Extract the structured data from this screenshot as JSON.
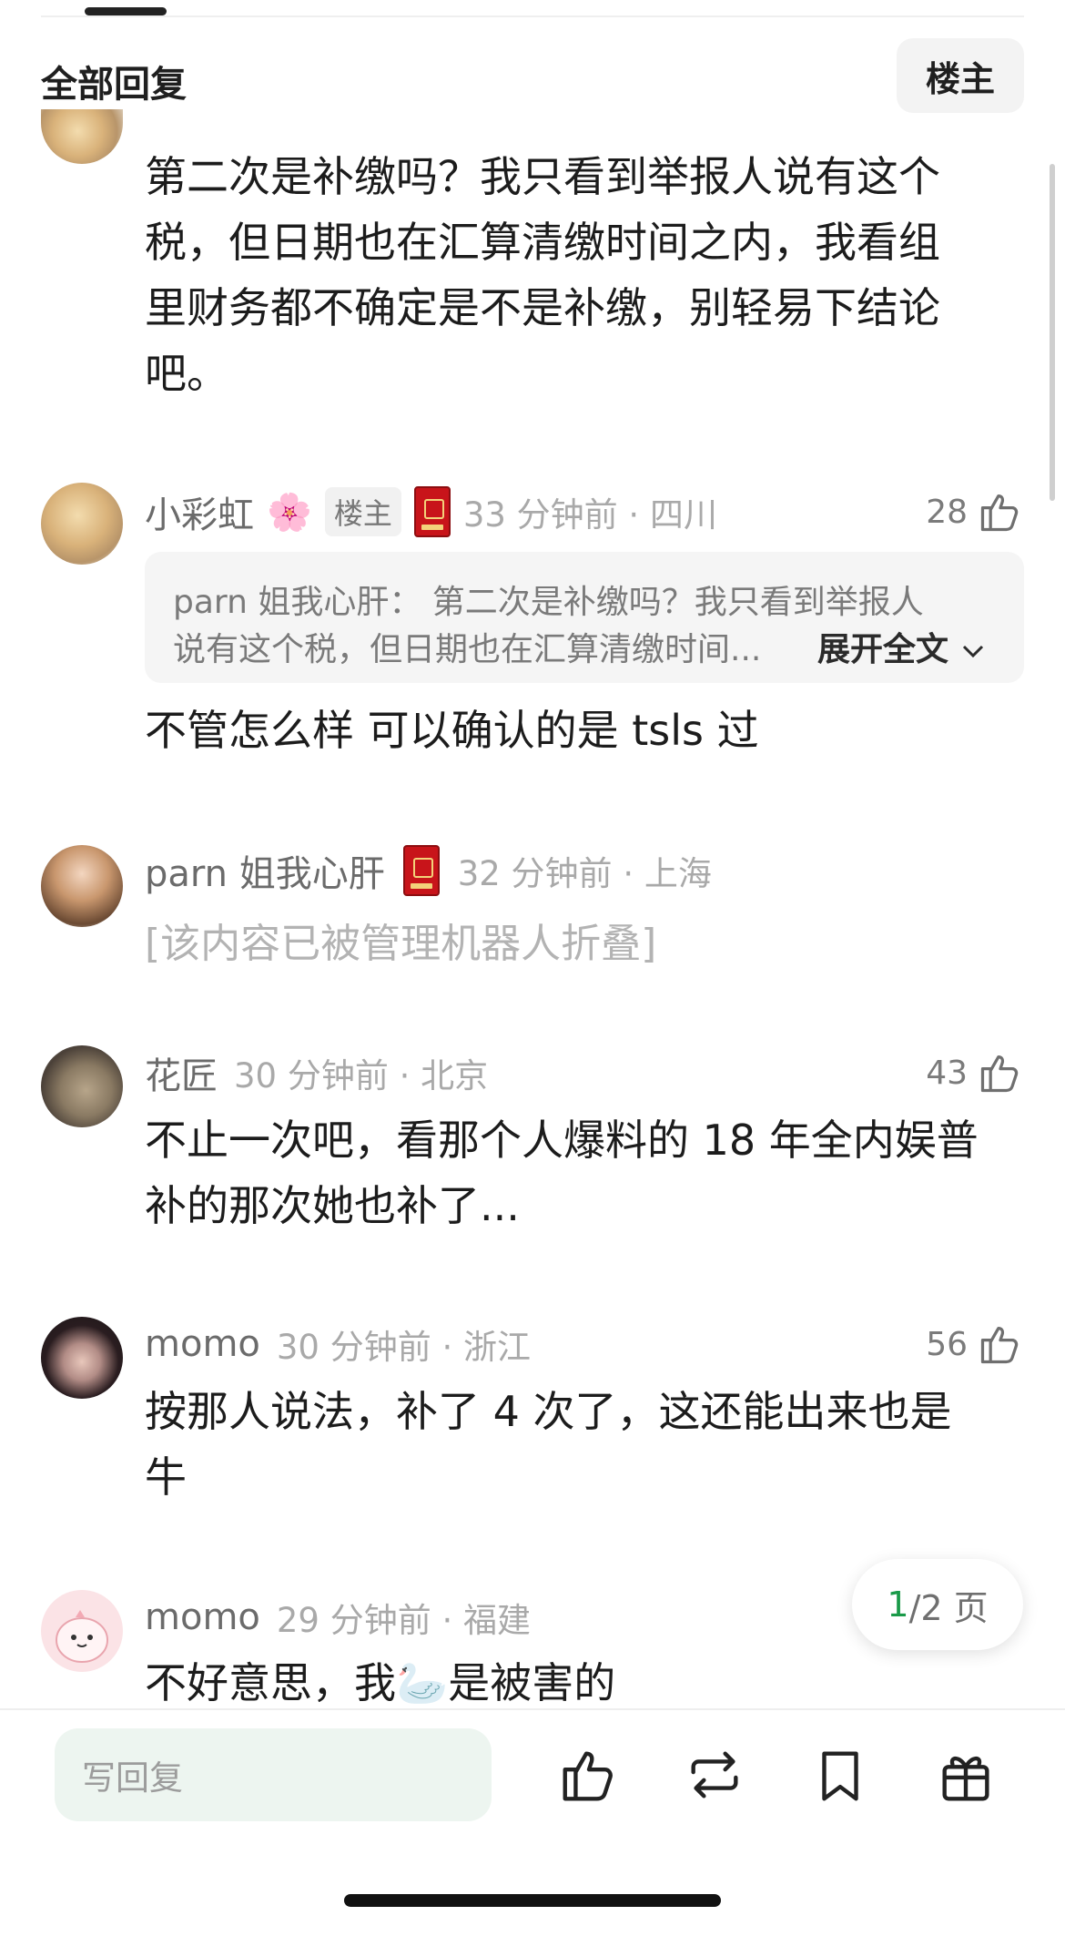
{
  "header": {
    "title": "全部回复",
    "op_filter_label": "楼主"
  },
  "comments": [
    {
      "text": "第二次是补缴吗？我只看到举报人说有这个税，但日期也在汇算清缴时间之内，我看组里财务都不确定是不是补缴，别轻易下结论吧。",
      "lines": [
        "第二次是补缴吗？我只看到举报人说有这个",
        "税，但日期也在汇算清缴时间之内，我看组",
        "里财务都不确定是不是补缴，别轻易下结论",
        "吧。"
      ]
    },
    {
      "username": "小彩虹",
      "flower_emoji": "🌸",
      "badge": "楼主",
      "time_location": "33 分钟前 · 四川",
      "likes": "28",
      "quote_line1": "parn 姐我心肝：  第二次是补缴吗？我只看到举报人",
      "quote_line2": "说有这个税，但日期也在汇算清缴时间...",
      "quote_expand": "展开全文",
      "text": "不管怎么样 可以确认的是 tsls 过"
    },
    {
      "username": "parn 姐我心肝",
      "time_location": "32 分钟前 · 上海",
      "text": "[该内容已被管理机器人折叠]"
    },
    {
      "username": "花匠",
      "time_location": "30 分钟前 · 北京",
      "likes": "43",
      "lines": [
        "不止一次吧，看那个人爆料的 18 年全内娱普",
        "补的那次她也补了..."
      ]
    },
    {
      "username": "momo",
      "time_location": "30 分钟前 · 浙江",
      "likes": "56",
      "lines": [
        "按那人说法，补了 4 次了，这还能出来也是",
        "牛"
      ]
    },
    {
      "username": "momo",
      "time_location": "29 分钟前 · 福建",
      "text_before": "不好意思，我",
      "swan_emoji": "🦢",
      "text_after": "是被害的"
    }
  ],
  "pagination": {
    "current": "1",
    "rest": "/2 页"
  },
  "bottom_bar": {
    "reply_placeholder": "写回复",
    "icons": [
      "like-icon",
      "repost-icon",
      "bookmark-icon",
      "gift-icon"
    ]
  }
}
